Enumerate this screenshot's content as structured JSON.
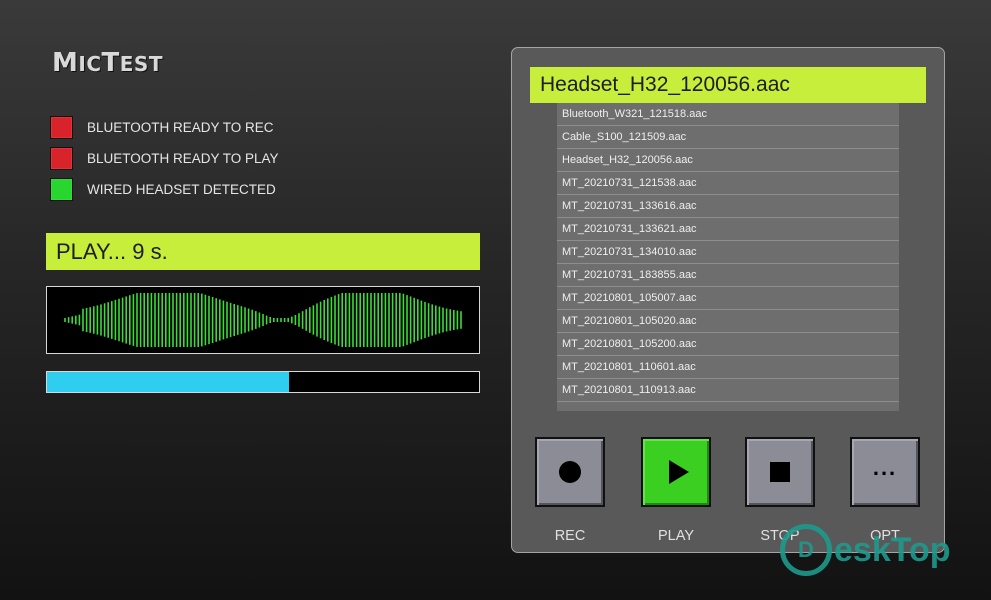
{
  "app": {
    "title_first": "M",
    "title_first_rest": "IC",
    "title_second": "T",
    "title_second_rest": "EST"
  },
  "status": [
    {
      "label": "BLUETOOTH READY TO REC",
      "color": "#d8232a"
    },
    {
      "label": "BLUETOOTH READY TO PLAY",
      "color": "#d8232a"
    },
    {
      "label": "WIRED HEADSET DETECTED",
      "color": "#27d62e"
    }
  ],
  "player": {
    "status_text": "PLAY... 9 s.",
    "progress": 0.56
  },
  "waveform": {
    "color": "#3ddb3a"
  },
  "files": {
    "current": "Headset_H32_120056.aac",
    "items": [
      "Bluetooth_W321_121518.aac",
      "Cable_S100_121509.aac",
      "Headset_H32_120056.aac",
      "MT_20210731_121538.aac",
      "MT_20210731_133616.aac",
      "MT_20210731_133621.aac",
      "MT_20210731_134010.aac",
      "MT_20210731_183855.aac",
      "MT_20210801_105007.aac",
      "MT_20210801_105020.aac",
      "MT_20210801_105200.aac",
      "MT_20210801_110601.aac",
      "MT_20210801_110913.aac"
    ]
  },
  "controls": {
    "rec": "REC",
    "play": "PLAY",
    "stop": "STOP",
    "opt": "OPT"
  },
  "watermark": {
    "text": "eskTop",
    "logo_glyph": "D"
  },
  "colors": {
    "accent": "#c8ee3c",
    "progress": "#2fcdf0",
    "panel": "#595959"
  }
}
